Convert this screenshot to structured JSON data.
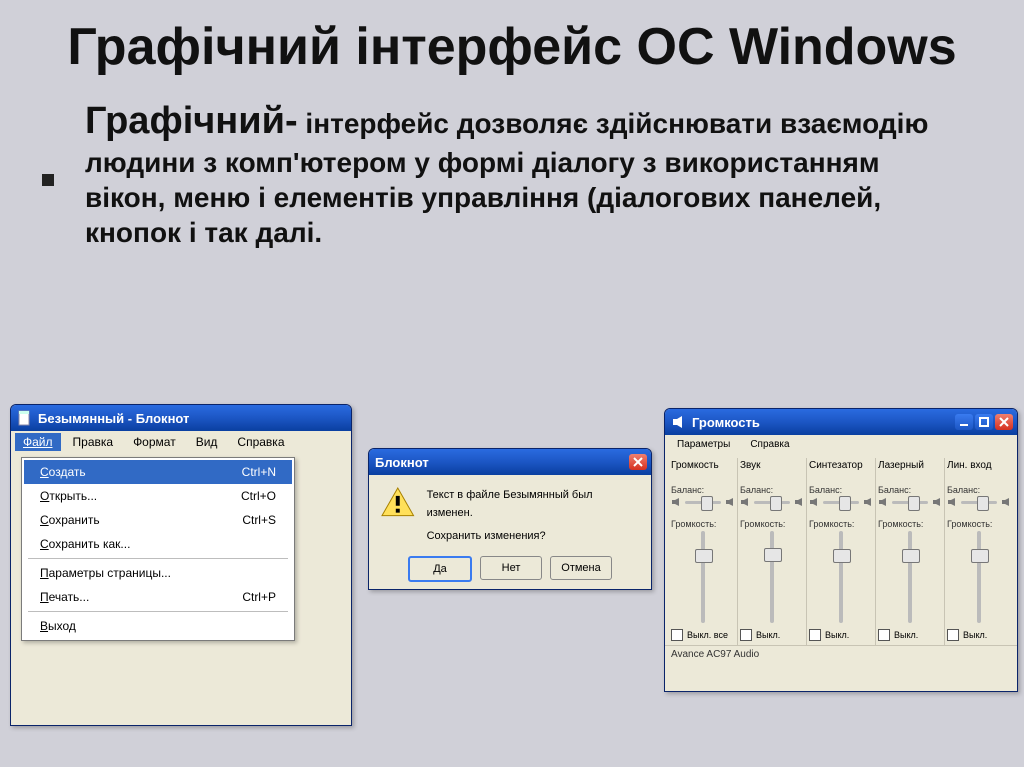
{
  "slide": {
    "title": "Графічний інтерфейс ОС Windows",
    "body_lead": "Графічний-",
    "body_text": " інтерфейс дозволяє здійснювати взаємодію людини з комп'ютером у формі діалогу з використанням вікон, меню і елементів управління (діалогових панелей, кнопок і так далі."
  },
  "notepad": {
    "title": "Безымянный - Блокнот",
    "menus": [
      "Файл",
      "Правка",
      "Формат",
      "Вид",
      "Справка"
    ],
    "dropdown": [
      {
        "label": "Создать",
        "shortcut": "Ctrl+N",
        "selected": true
      },
      {
        "label": "Открыть...",
        "shortcut": "Ctrl+O",
        "selected": false
      },
      {
        "label": "Сохранить",
        "shortcut": "Ctrl+S",
        "selected": false
      },
      {
        "label": "Сохранить как...",
        "shortcut": "",
        "selected": false
      },
      {
        "sep": true
      },
      {
        "label": "Параметры страницы...",
        "shortcut": "",
        "selected": false
      },
      {
        "label": "Печать...",
        "shortcut": "Ctrl+P",
        "selected": false
      },
      {
        "sep": true
      },
      {
        "label": "Выход",
        "shortcut": "",
        "selected": false
      }
    ]
  },
  "msgbox": {
    "title": "Блокнот",
    "line1": "Текст в файле Безымянный был изменен.",
    "line2": "Сохранить изменения?",
    "buttons": {
      "yes": "Да",
      "no": "Нет",
      "cancel": "Отмена"
    }
  },
  "mixer": {
    "title": "Громкость",
    "menus": [
      "Параметры",
      "Справка"
    ],
    "balance_label": "Баланс:",
    "volume_label": "Громкость:",
    "channels": [
      {
        "name": "Громкость",
        "mute_label": "Выкл. все",
        "vol_top_pct": 20
      },
      {
        "name": "Звук",
        "mute_label": "Выкл.",
        "vol_top_pct": 18
      },
      {
        "name": "Синтезатор",
        "mute_label": "Выкл.",
        "vol_top_pct": 20
      },
      {
        "name": "Лазерный",
        "mute_label": "Выкл.",
        "vol_top_pct": 20
      },
      {
        "name": "Лин. вход",
        "mute_label": "Выкл.",
        "vol_top_pct": 20
      }
    ],
    "status": "Avance AC97 Audio"
  }
}
